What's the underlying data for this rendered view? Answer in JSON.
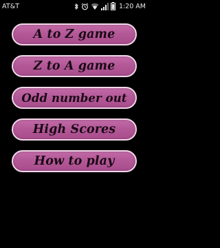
{
  "status_bar": {
    "carrier": "AT&T",
    "time": "1:20 AM",
    "icons": [
      "bluetooth-icon",
      "alarm-icon",
      "wifi-icon",
      "signal-icon",
      "battery-icon"
    ]
  },
  "menu": {
    "items": [
      {
        "label": "A to Z game"
      },
      {
        "label": "Z to A game"
      },
      {
        "label": "Odd number out"
      },
      {
        "label": "High Scores"
      },
      {
        "label": "How to play"
      }
    ]
  },
  "colors": {
    "background": "#000000",
    "button_fill": "#b45998",
    "button_border": "#f2d8ea",
    "button_text": "#1a0a15"
  }
}
